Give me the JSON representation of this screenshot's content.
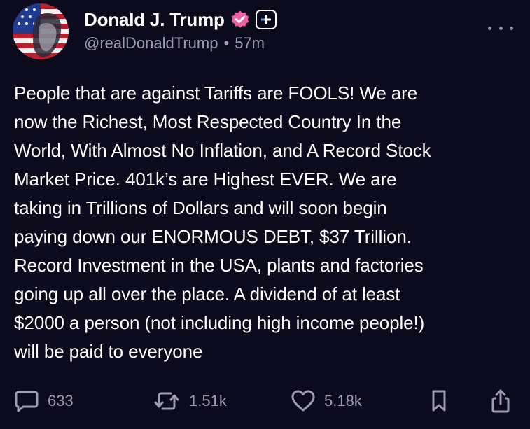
{
  "post": {
    "author": {
      "display_name": "Donald J. Trump",
      "handle": "@realDonaldTrump",
      "verified_badge_icon": "verified-badge-icon",
      "verified_color": "#ec5fa0"
    },
    "time_ago": "57m",
    "separator": "•",
    "more_icon": "ellipsis-icon",
    "body": "People that are against Tariffs are FOOLS! We are\nnow the Richest, Most Respected Country In the\nWorld, With Almost No Inflation, and A Record Stock\nMarket Price. 401k’s are Highest EVER. We are\ntaking in Trillions of Dollars and will soon begin\npaying down our ENORMOUS DEBT, $37 Trillion.\nRecord Investment in the USA, plants and factories\ngoing up all over the place. A dividend of at least\n$2000 a person (not including high income people!)\nwill be paid to everyone"
  },
  "actions": {
    "replies": {
      "icon": "reply-icon",
      "count": "633"
    },
    "retruths": {
      "icon": "retruth-icon",
      "count": "1.51k"
    },
    "likes": {
      "icon": "heart-icon",
      "count": "5.18k"
    },
    "bookmark": {
      "icon": "bookmark-icon"
    },
    "share": {
      "icon": "share-icon"
    }
  },
  "colors": {
    "background": "#0c0b1d",
    "text_primary": "#ffffff",
    "text_secondary": "#9d9cae"
  }
}
